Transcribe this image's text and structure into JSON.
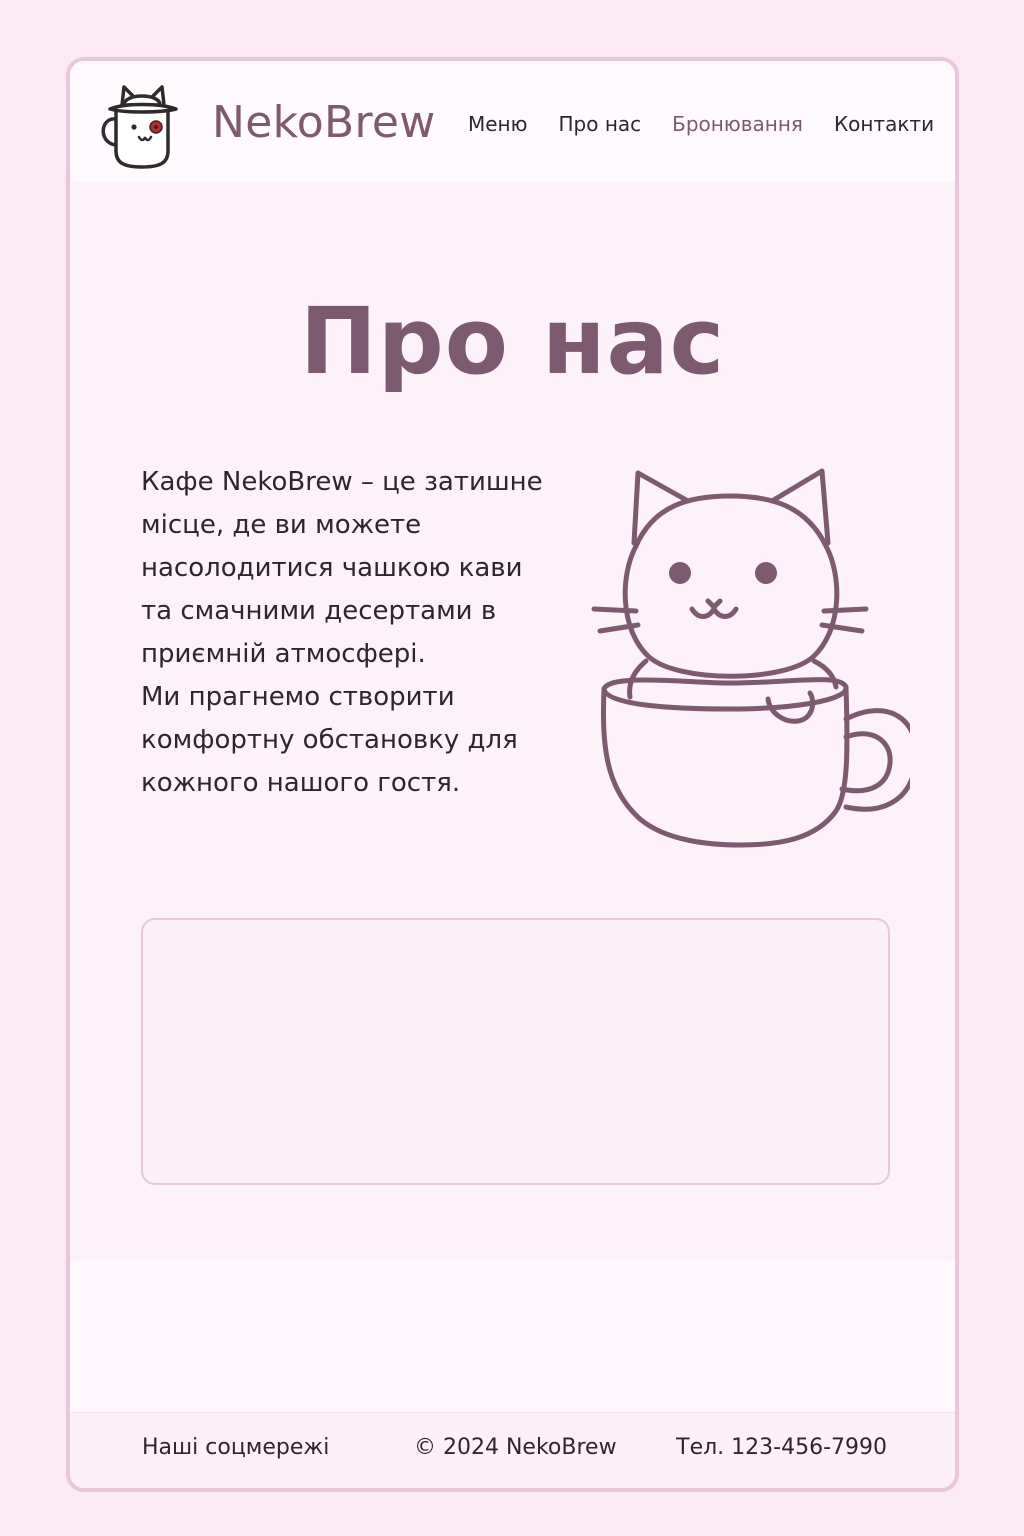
{
  "header": {
    "brand": "NekoBrew",
    "nav": [
      {
        "label": "Меню"
      },
      {
        "label": "Про нас"
      },
      {
        "label": "Бронювання"
      },
      {
        "label": "Контакти"
      }
    ],
    "active_nav": "Бронювання"
  },
  "main": {
    "title": "Про нас",
    "paragraph1": "Кафе NekoBrew – це затишне місце, де ви можете насолодитися чашкою кави та смачними десертами в приємній атмосфері.",
    "paragraph2": "Ми прагнемо створити комфортну обстановку для кожного нашого гостя."
  },
  "footer": {
    "social": "Наші соцмережі",
    "copyright": "© 2024 NekoBrew",
    "phone": "Тел. 123-456-7990"
  },
  "colors": {
    "accent": "#7d5a6f",
    "background": "#fbe9f4",
    "border": "#e9c6dc",
    "text": "#2f2530"
  },
  "icons": {
    "logo": "cat-mug-logo-icon",
    "illustration": "cat-in-cup-icon"
  }
}
